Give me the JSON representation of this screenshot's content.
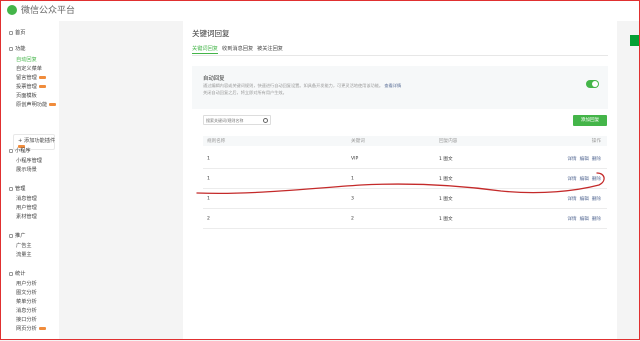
{
  "app": {
    "title": "微信公众平台"
  },
  "sidebar": {
    "home": "首页",
    "groups": [
      {
        "title": "功能",
        "items": [
          "自动回复",
          "自定义菜单",
          "留言管理",
          "投票管理",
          "页面模板",
          "原创声明功能"
        ],
        "active": "自动回复",
        "hot": [
          "留言管理",
          "投票管理",
          "原创声明功能"
        ]
      },
      {
        "title": "小程序",
        "items": [
          "小程序管理",
          "展示场景"
        ]
      },
      {
        "title": "管理",
        "items": [
          "消息管理",
          "用户管理",
          "素材管理"
        ]
      },
      {
        "title": "推广",
        "items": [
          "广告主",
          "流量主"
        ]
      },
      {
        "title": "统计",
        "items": [
          "用户分析",
          "图文分析",
          "菜单分析",
          "消息分析",
          "接口分析",
          "网页分析"
        ]
      }
    ],
    "plugin": "添加功能插件"
  },
  "main": {
    "title": "关键词回复",
    "tabs": [
      "关键词回复",
      "收到消息回复",
      "被关注回复"
    ],
    "auto_reply": {
      "title": "自动回复",
      "desc_line1": "通过编辑内容或关键词规则，快速进行自动回复设置。如具备开发能力，可更灵活地使用该功能。",
      "link": "查看详情",
      "desc_line2": "关闭自动回复之后，将立即对所有用户生效。",
      "enabled": true
    },
    "search": {
      "placeholder": "搜索关键词/规则名称"
    },
    "add_button": "添加回复",
    "table": {
      "columns": [
        "规则名称",
        "关键词",
        "回复内容",
        "操作"
      ],
      "rows": [
        {
          "name": "1",
          "keyword": "VIP",
          "reply": "1 图文",
          "ops": [
            "详情",
            "编辑",
            "删除"
          ]
        },
        {
          "name": "1",
          "keyword": "1",
          "reply": "1 图文",
          "ops": [
            "详情",
            "编辑",
            "删除"
          ]
        },
        {
          "name": "1",
          "keyword": "3",
          "reply": "1 图文",
          "ops": [
            "详情",
            "编辑",
            "删除"
          ]
        },
        {
          "name": "2",
          "keyword": "2",
          "reply": "1 图文",
          "ops": [
            "详情",
            "编辑",
            "删除"
          ]
        }
      ]
    }
  },
  "colors": {
    "accent": "#44b549",
    "annotation": "#c42a2a",
    "link": "#576b95"
  }
}
